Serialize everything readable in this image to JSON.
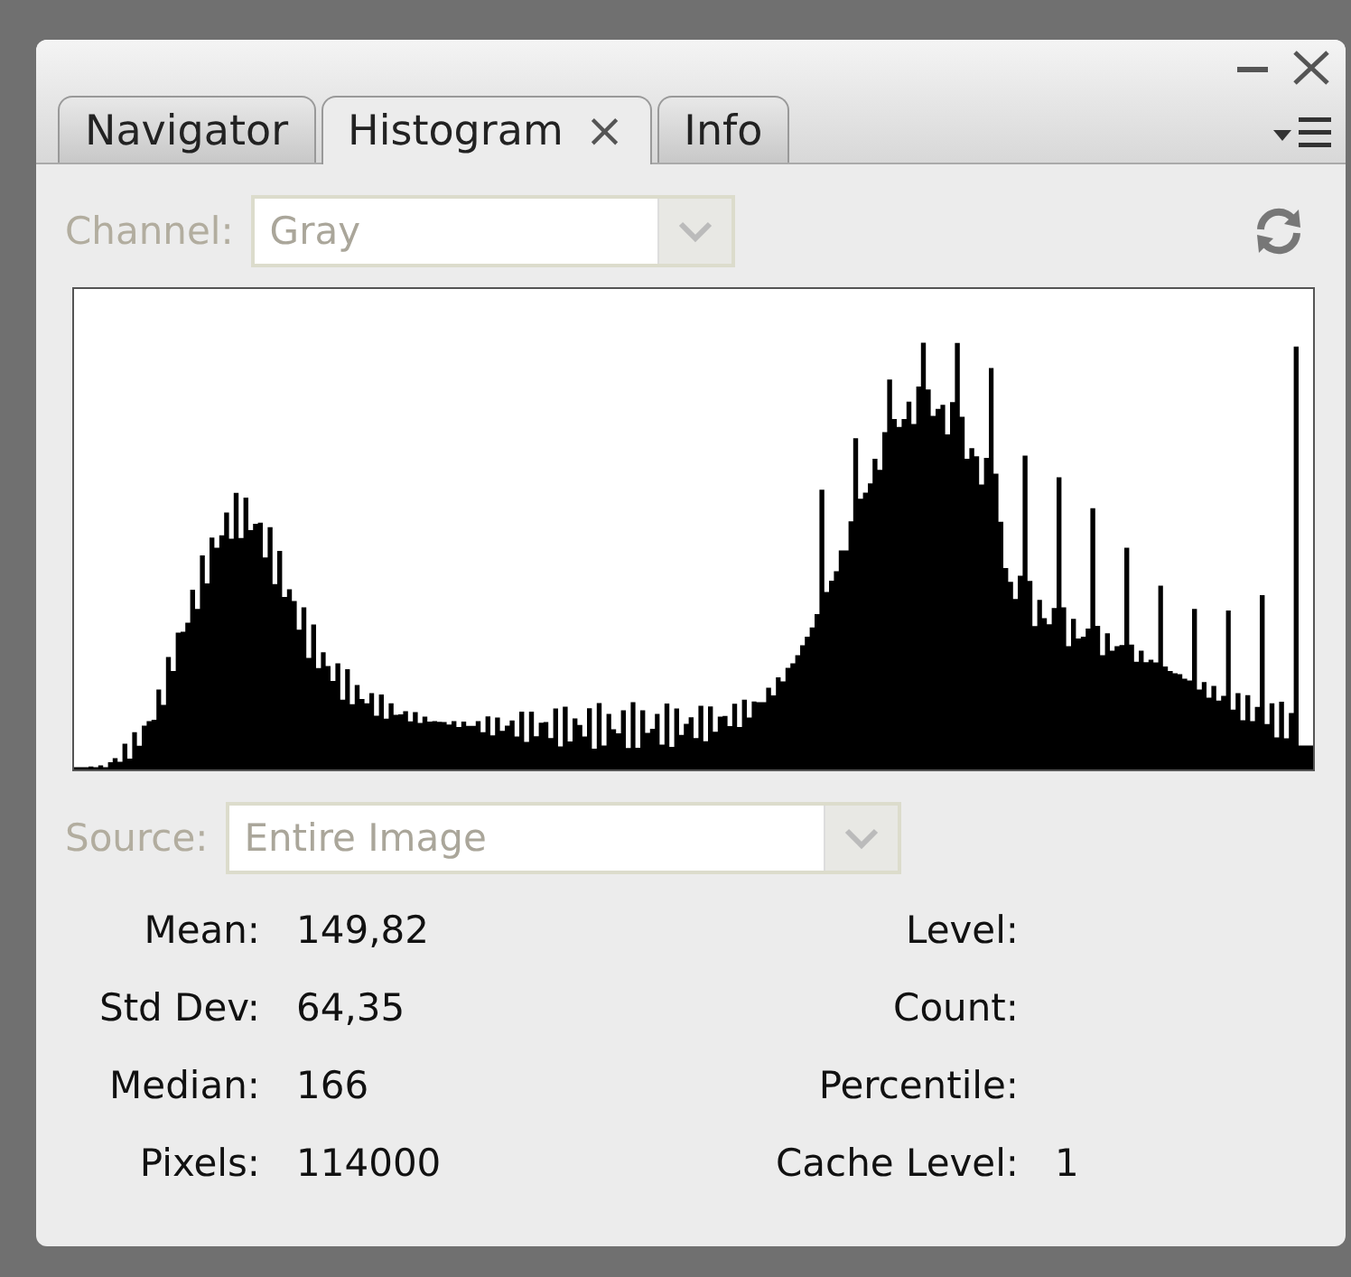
{
  "tabs": [
    {
      "label": "Navigator",
      "selected": false
    },
    {
      "label": "Histogram",
      "selected": true,
      "close": "×"
    },
    {
      "label": "Info",
      "selected": false
    }
  ],
  "channel": {
    "label": "Channel:",
    "value": "Gray",
    "disabled": true
  },
  "source": {
    "label": "Source:",
    "value": "Entire Image",
    "disabled": true
  },
  "stats_left": [
    {
      "label": "Mean:",
      "value": "149,82"
    },
    {
      "label": "Std Dev:",
      "value": "64,35"
    },
    {
      "label": "Median:",
      "value": "166"
    },
    {
      "label": "Pixels:",
      "value": "114000"
    }
  ],
  "stats_right": [
    {
      "label": "Level:"
    },
    {
      "label": "Count:"
    },
    {
      "label": "Percentile:"
    },
    {
      "label": "Cache Level:",
      "value": "1"
    }
  ]
}
